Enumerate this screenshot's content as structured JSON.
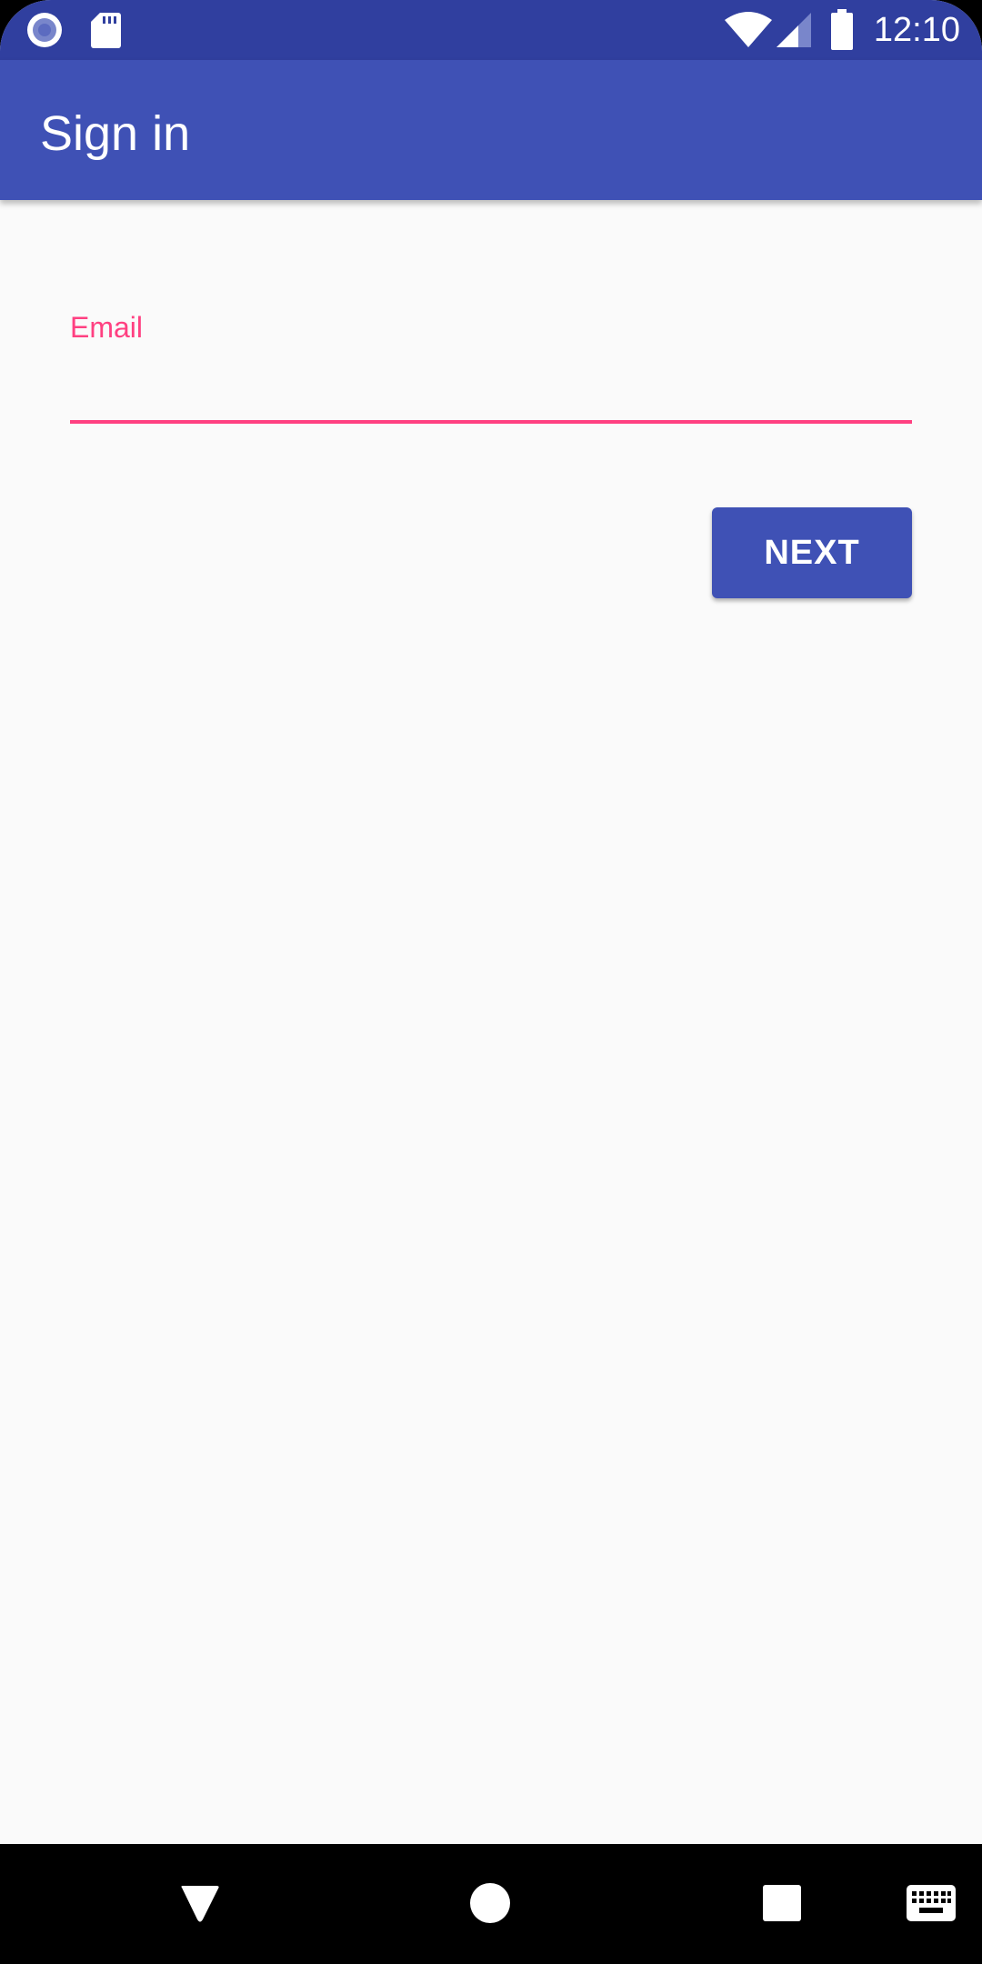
{
  "status_bar": {
    "time": "12:10",
    "left_icons": [
      "record-icon",
      "sd-card-icon"
    ],
    "right_icons": [
      "wifi-icon",
      "cell-signal-icon",
      "battery-icon"
    ]
  },
  "app_bar": {
    "title": "Sign in"
  },
  "form": {
    "email_label": "Email",
    "email_value": "",
    "next_label": "NEXT"
  },
  "nav_bar": {
    "icons": [
      "back-icon",
      "home-icon",
      "recents-icon",
      "keyboard-icon"
    ]
  },
  "colors": {
    "status_bar": "#303f9f",
    "primary": "#3f51b5",
    "accent": "#ff4081",
    "background": "#fafafa"
  }
}
